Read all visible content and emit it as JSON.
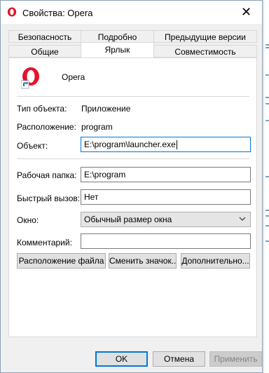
{
  "window": {
    "title": "Свойства: Opera",
    "close_glyph": "✕"
  },
  "tabs": {
    "row1": [
      "Безопасность",
      "Подробно",
      "Предыдущие версии"
    ],
    "row2": [
      "Общие",
      "Ярлык",
      "Совместимость"
    ],
    "active": "Ярлык"
  },
  "shortcut": {
    "name": "Opera",
    "type_label": "Тип объекта:",
    "type_value": "Приложение",
    "location_label": "Расположение:",
    "location_value": "program",
    "target_label": "Объект:",
    "target_value": "E:\\program\\launcher.exe",
    "start_in_label": "Рабочая папка:",
    "start_in_value": "E:\\program",
    "hotkey_label": "Быстрый вызов:",
    "hotkey_value": "Нет",
    "run_label": "Окно:",
    "run_value": "Обычный размер окна",
    "comment_label": "Комментарий:",
    "comment_value": ""
  },
  "buttons": {
    "open_location": "Расположение файла",
    "change_icon": "Сменить значок...",
    "advanced": "Дополнительно...",
    "ok": "OK",
    "cancel": "Отмена",
    "apply": "Применить"
  },
  "colors": {
    "opera_red": "#e0162b",
    "accent": "#0078d7"
  },
  "icons": {
    "app": "opera-icon",
    "close": "close-icon",
    "shortcut_arrow": "shortcut-arrow-icon",
    "dropdown": "chevron-down-icon"
  }
}
